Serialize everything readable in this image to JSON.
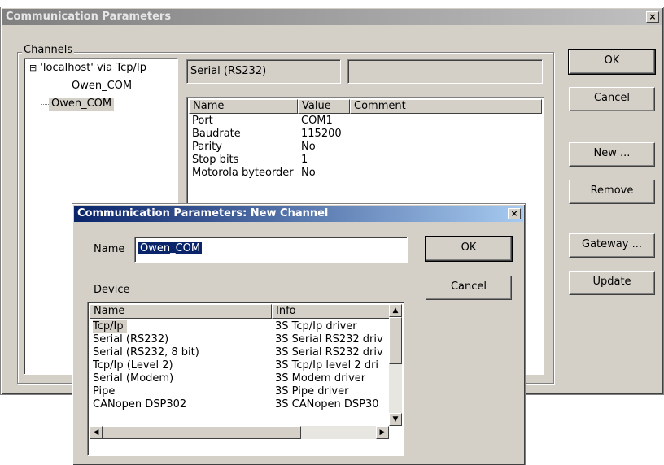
{
  "main_window": {
    "title": "Communication Parameters",
    "close_glyph": "×",
    "channels_group_label": "Channels",
    "tree": [
      {
        "label": "'localhost' via Tcp/Ip",
        "expander": "⊟"
      },
      {
        "label": "Owen_COM"
      },
      {
        "label": "Owen_COM"
      }
    ],
    "channel_type": "Serial (RS232)",
    "channel_extra": "",
    "params_columns": [
      "Name",
      "Value",
      "Comment"
    ],
    "params": [
      {
        "name": "Port",
        "value": "COM1",
        "comment": ""
      },
      {
        "name": "Baudrate",
        "value": "115200",
        "comment": ""
      },
      {
        "name": "Parity",
        "value": "No",
        "comment": ""
      },
      {
        "name": "Stop bits",
        "value": "1",
        "comment": ""
      },
      {
        "name": "Motorola byteorder",
        "value": "No",
        "comment": ""
      }
    ],
    "buttons": {
      "ok": "OK",
      "cancel": "Cancel",
      "new": "New ...",
      "remove": "Remove",
      "gateway": "Gateway ...",
      "update": "Update"
    }
  },
  "dialog": {
    "title": "Communication Parameters: New Channel",
    "close_glyph": "×",
    "name_label": "Name",
    "name_value": "Owen_COM",
    "device_label": "Device",
    "ok": "OK",
    "cancel": "Cancel",
    "device_columns": [
      "Name",
      "Info"
    ],
    "devices": [
      {
        "name": "Tcp/Ip",
        "info": "3S Tcp/Ip driver"
      },
      {
        "name": "Serial (RS232)",
        "info": "3S Serial RS232 driv"
      },
      {
        "name": "Serial (RS232, 8 bit)",
        "info": "3S Serial RS232 driv"
      },
      {
        "name": "Tcp/Ip (Level 2)",
        "info": "3S Tcp/Ip level 2 dri"
      },
      {
        "name": "Serial (Modem)",
        "info": "3S Modem driver"
      },
      {
        "name": "Pipe",
        "info": "3S Pipe driver"
      },
      {
        "name": "CANopen DSP302",
        "info": "3S CANopen DSP30"
      }
    ],
    "scroll_glyphs": {
      "up": "▲",
      "down": "▼",
      "left": "◀",
      "right": "▶"
    }
  },
  "colors": {
    "face": "#d4d0c8",
    "active_title": "#0a246a",
    "inactive_title": "#808080"
  }
}
